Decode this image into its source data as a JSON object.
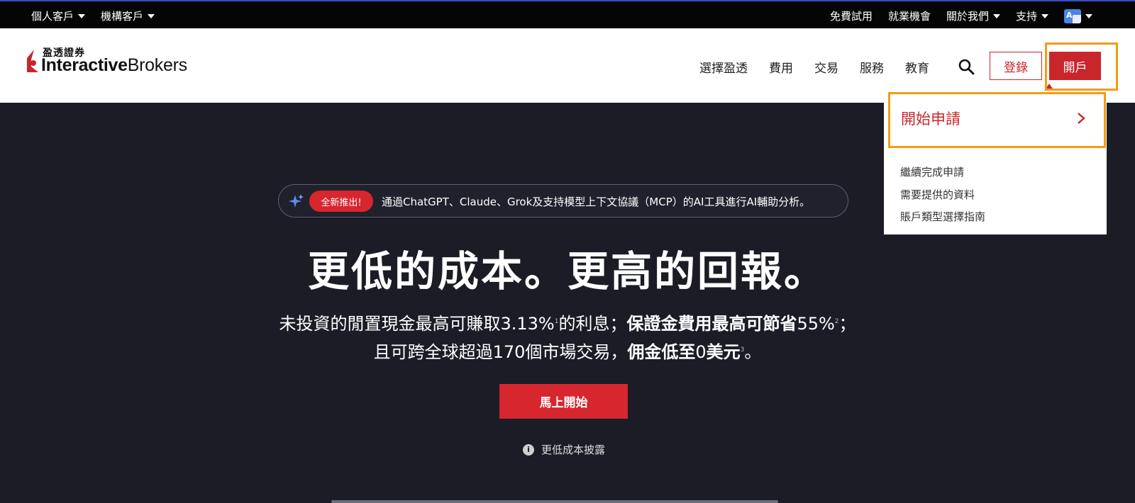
{
  "topbar": {
    "left": [
      {
        "label": "個人客戶"
      },
      {
        "label": "機構客戶"
      }
    ],
    "right": {
      "free_trial": "免費試用",
      "careers": "就業機會",
      "about": "關於我們",
      "support": "支持",
      "lang_glyph": "A"
    }
  },
  "header": {
    "logo_cn": "盈透證券",
    "logo_en_bold": "Interactive",
    "logo_en_regular": "Brokers",
    "nav": [
      {
        "label": "選擇盈透"
      },
      {
        "label": "費用"
      },
      {
        "label": "交易"
      },
      {
        "label": "服務"
      },
      {
        "label": "教育"
      }
    ],
    "login": "登錄",
    "open_account": "開戶"
  },
  "dropdown": {
    "main": "開始申請",
    "items": [
      {
        "label": "繼續完成申請"
      },
      {
        "label": "需要提供的資料"
      },
      {
        "label": "賬戶類型選擇指南"
      }
    ]
  },
  "hero": {
    "badge": "全新推出!",
    "announcement": "通過ChatGPT、Claude、Grok及支持模型上下文協議（MCP）的AI工具進行AI輔助分析。",
    "headline": "更低的成本。更高的回報。",
    "line1_a": "未投資的閒置現金最高可賺取3.13%",
    "line1_sup1": "1",
    "line1_b": "的利息；",
    "line1_bold": "保證金費用最高可節省",
    "line1_c": "55%",
    "line1_sup2": "2",
    "line1_d": "；",
    "line2_a": "且可跨全球超過170個市場交易，",
    "line2_bold1": "佣金低至",
    "line2_b": "0",
    "line2_bold2": "美元",
    "line2_sup3": "3",
    "line2_c": "。",
    "cta": "馬上開始",
    "disclosure": "更低成本披露"
  },
  "colors": {
    "brand_red": "#c9262c",
    "highlight": "#f39c12",
    "hero_bg": "#1b1c26"
  }
}
